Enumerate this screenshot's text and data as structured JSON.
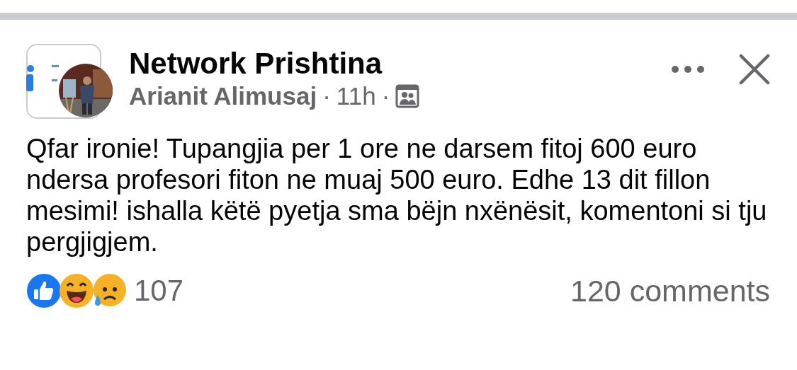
{
  "post": {
    "page_name": "Network Prishtina",
    "author": "Arianit Alimusaj",
    "separator_1": "·",
    "time": "11h",
    "separator_2": "·",
    "group_audience": true,
    "text": "Qfar ironie! Tupangjia per 1 ore ne darsem fitoj 600 euro ndersa profesori fiton ne muaj 500 euro. Edhe 13 dit fillon mesimi! ishalla këtë pyetja sma bëjn nxënësit, komentoni si tju pergjigjem.",
    "reactions": [
      {
        "kind": "like"
      },
      {
        "kind": "haha"
      },
      {
        "kind": "sad"
      }
    ],
    "reaction_count": "107",
    "comments": "120 comments"
  }
}
